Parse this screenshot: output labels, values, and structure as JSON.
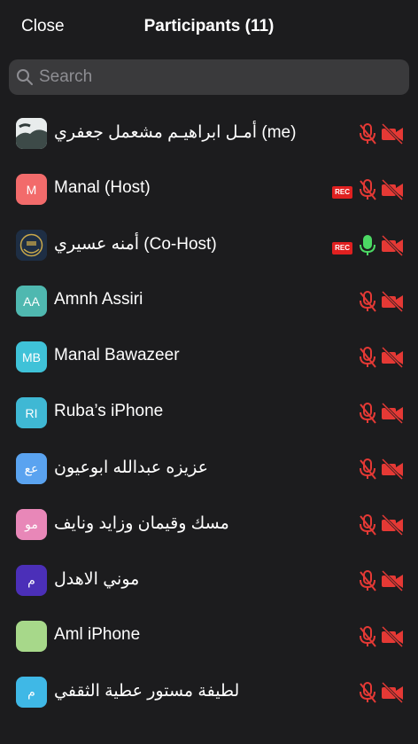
{
  "header": {
    "close_label": "Close",
    "title": "Participants (11)"
  },
  "search": {
    "placeholder": "Search"
  },
  "colors": {
    "background": "#1c1c1e",
    "muted_icon": "#e53935",
    "active_mic": "#4cd964",
    "rec_badge": "#e02020"
  },
  "participants": [
    {
      "name": "أمـل ابراهيـم مشعمل جعفري (me)",
      "initials": "",
      "avatar_kind": "image-landscape",
      "avatar_color": "#5d6b6a",
      "rec": false,
      "mic": "muted",
      "video": "off"
    },
    {
      "name": "Manal (Host)",
      "initials": "M",
      "avatar_kind": "initials",
      "avatar_color": "#f26b6b",
      "rec": true,
      "rec_label": "REC",
      "mic": "muted",
      "video": "off"
    },
    {
      "name": "أمنه عسيري (Co-Host)",
      "initials": "",
      "avatar_kind": "image-emblem",
      "avatar_color": "#20324a",
      "rec": true,
      "rec_label": "REC",
      "mic": "active",
      "video": "off"
    },
    {
      "name": "Amnh Assiri",
      "initials": "AA",
      "avatar_kind": "initials",
      "avatar_color": "#4fb8b0",
      "rec": false,
      "mic": "muted",
      "video": "off"
    },
    {
      "name": "Manal Bawazeer",
      "initials": "MB",
      "avatar_kind": "initials",
      "avatar_color": "#3fc2d8",
      "rec": false,
      "mic": "muted",
      "video": "off"
    },
    {
      "name": "Ruba’s iPhone",
      "initials": "RI",
      "avatar_kind": "initials",
      "avatar_color": "#3fb8d4",
      "rec": false,
      "mic": "muted",
      "video": "off"
    },
    {
      "name": "عزيزه عبدالله ابوعيون",
      "initials": "عع",
      "avatar_kind": "initials",
      "avatar_color": "#5aa3f0",
      "rec": false,
      "mic": "muted",
      "video": "off"
    },
    {
      "name": "مسك وقيمان وزايد ونايف",
      "initials": "مو",
      "avatar_kind": "initials",
      "avatar_color": "#e887b8",
      "rec": false,
      "mic": "muted",
      "video": "off"
    },
    {
      "name": "موني الاهدل",
      "initials": "م",
      "avatar_kind": "initials",
      "avatar_color": "#4b2fb8",
      "rec": false,
      "mic": "muted",
      "video": "off"
    },
    {
      "name": "Aml iPhone",
      "initials": "",
      "avatar_kind": "initials",
      "avatar_color": "#a7d88a",
      "rec": false,
      "mic": "muted",
      "video": "off"
    },
    {
      "name": "لطيفة مستور عطية الثقفي",
      "initials": "م",
      "avatar_kind": "initials",
      "avatar_color": "#3fb8e6",
      "rec": false,
      "mic": "muted",
      "video": "off"
    }
  ]
}
